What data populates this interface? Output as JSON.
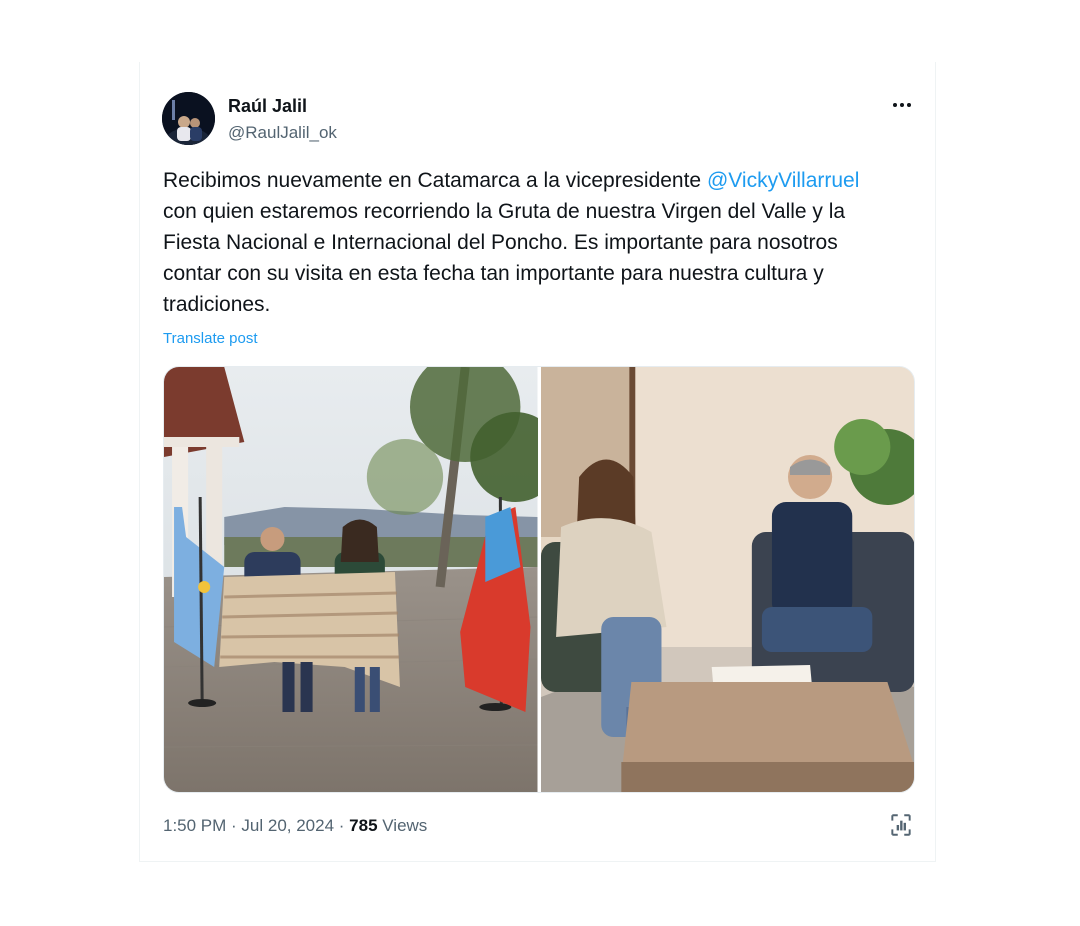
{
  "post": {
    "author_name": "Raúl Jalil",
    "author_handle": "@RaulJalil_ok",
    "text_before_mention": "Recibimos nuevamente en Catamarca a la vicepresidente ",
    "mention": "@VickyVillarruel",
    "text_after_mention": "\ncon quien estaremos recorriendo la Gruta de nuestra Virgen del Valle y la\nFiesta Nacional e Internacional del Poncho. Es importante para nosotros\ncontar con su visita en esta fecha tan importante para nuestra cultura y\ntradiciones.",
    "translate_label": "Translate post",
    "time": "1:50 PM",
    "separator": " · ",
    "date": "Jul 20, 2024",
    "views_count": "785",
    "views_label": " Views"
  },
  "icons": {
    "more": "more-horizontal-icon",
    "analytics": "analytics-icon"
  },
  "colors": {
    "link": "#1d9bf0",
    "secondary_text": "#536471",
    "primary_text": "#0f1419"
  }
}
